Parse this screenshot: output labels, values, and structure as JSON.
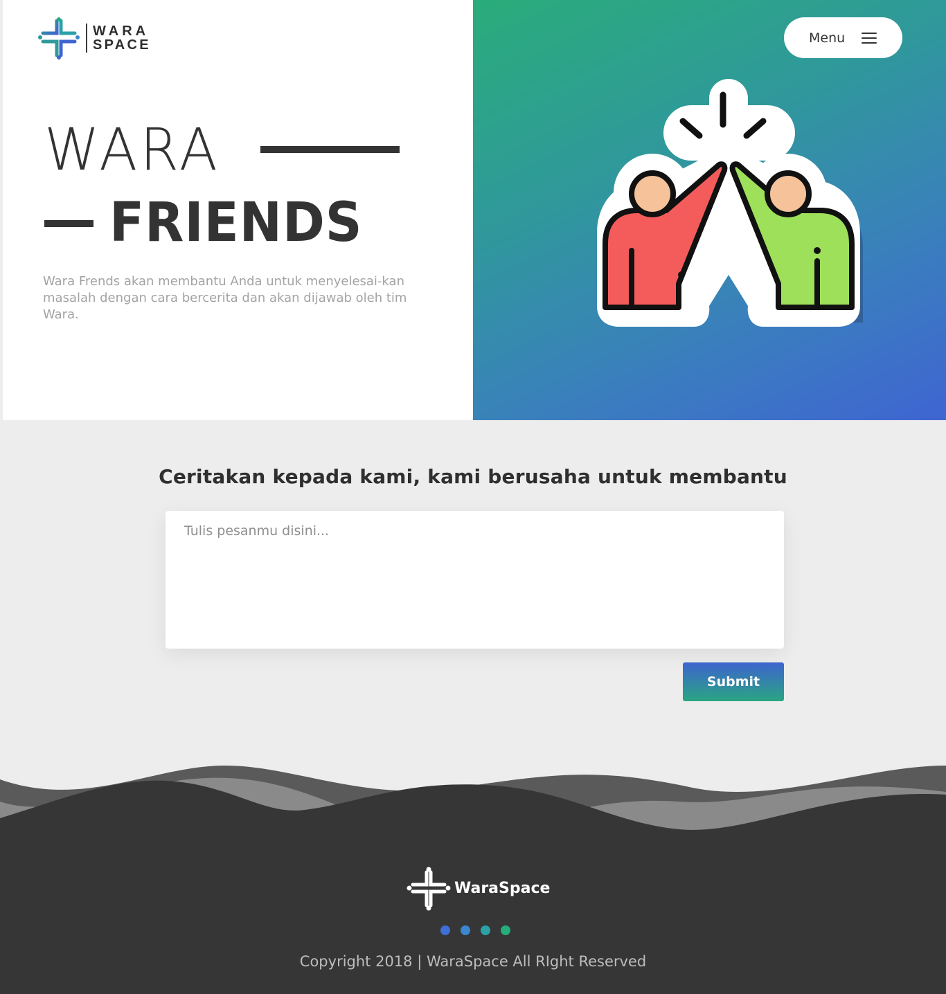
{
  "header": {
    "logo": {
      "line1": "WARA",
      "line2": "SPACE"
    },
    "menu_label": "Menu"
  },
  "hero": {
    "title_line1": "WARA",
    "title_line2": "FRIENDS",
    "description": "Wara Frends akan membantu Anda untuk menyelesai-kan masalah dengan cara bercerita dan akan dijawab oleh tim Wara.",
    "illustration_icon": "high-five-icon"
  },
  "form": {
    "heading": "Ceritakan kepada kami, kami berusaha untuk membantu",
    "message_placeholder": "Tulis pesanmu disini...",
    "message_value": "",
    "submit_label": "Submit"
  },
  "footer": {
    "brand": "WaraSpace",
    "dots": [
      "#3f6fd6",
      "#3a86cf",
      "#2aa2a8",
      "#25ae7a"
    ],
    "copyright": "Copyright 2018 | WaraSpace All RIght Reserved"
  },
  "colors": {
    "accent_green": "#2aac7a",
    "accent_blue": "#3f65d2",
    "dark": "#333333",
    "footer_bg": "#363636"
  }
}
